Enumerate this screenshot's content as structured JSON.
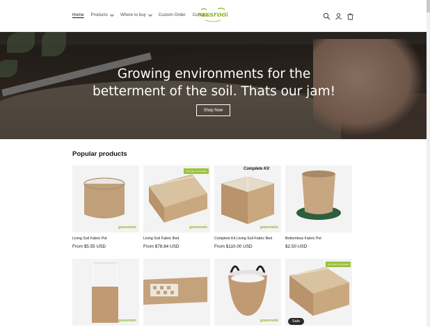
{
  "header": {
    "nav": [
      {
        "label": "Home",
        "active": true,
        "dropdown": false
      },
      {
        "label": "Products",
        "active": false,
        "dropdown": true
      },
      {
        "label": "Where to buy",
        "active": false,
        "dropdown": true
      },
      {
        "label": "Custom Order",
        "active": false,
        "dropdown": false
      },
      {
        "label": "Contact",
        "active": false,
        "dropdown": false
      }
    ],
    "logo_text": "grassroots",
    "icons": [
      "search-icon",
      "account-icon",
      "cart-icon"
    ]
  },
  "hero": {
    "heading_line1": "Growing environments for the",
    "heading_line2": "betterment of the soil. Thats our jam!",
    "button_label": "Shop Now"
  },
  "products_section": {
    "title": "Popular products",
    "products": [
      {
        "name": "Living Soil Fabric Pot",
        "price": "From $5.55 USD",
        "image": "round-fabric-pot"
      },
      {
        "name": "Living Soil Fabric Bed",
        "price": "From $78.84 USD",
        "image": "fabric-bed",
        "tag": "PVC pipe not included"
      },
      {
        "name": "Complete Kit Living Soil Fabric Bed",
        "price": "From $110.00 USD",
        "image": "complete-kit",
        "kit_label": "Complete Kit"
      },
      {
        "name": "Bottomless Fabric Pot",
        "price": "$2.50 USD",
        "image": "bottomless-pot"
      },
      {
        "name": "",
        "price": "",
        "image": "tall-frame-pot"
      },
      {
        "name": "",
        "price": "",
        "image": "flat-fabric-panel"
      },
      {
        "name": "",
        "price": "",
        "image": "handle-pot"
      },
      {
        "name": "",
        "price": "",
        "image": "fabric-bed-2",
        "tag": "PVC pipe not included"
      }
    ],
    "sale_badge": "Sale"
  },
  "colors": {
    "accent": "#9bc23d",
    "text": "#121212",
    "hero_overlay": "#000000"
  }
}
